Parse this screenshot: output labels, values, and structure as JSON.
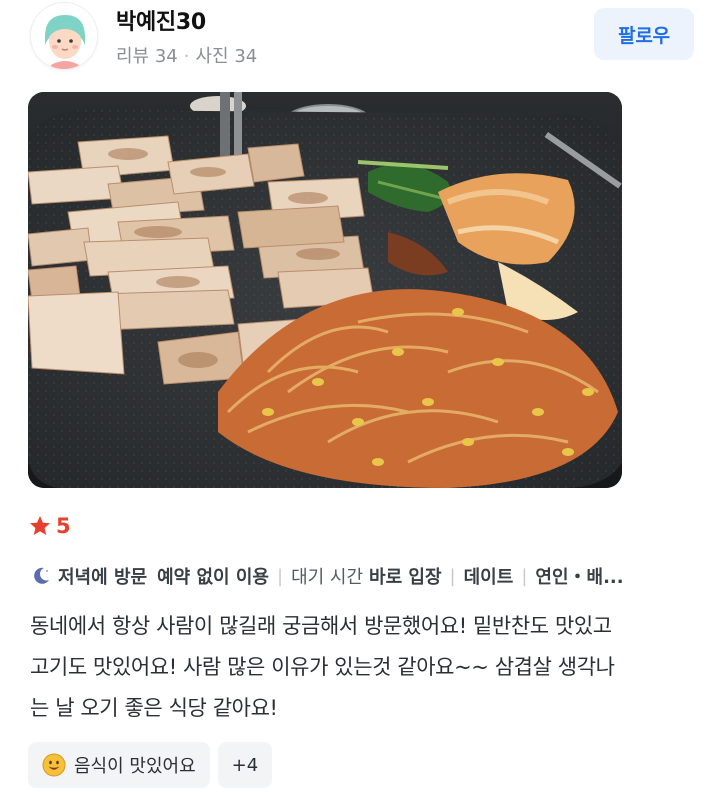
{
  "user": {
    "name": "박예진30",
    "reviews_label": "리뷰 34",
    "photos_label": "사진 34",
    "separator": "·",
    "follow_label": "팔로우"
  },
  "photo": {
    "description_icon": "food-photo"
  },
  "rating": {
    "value": "5",
    "star_color": "#e8402f"
  },
  "visit": {
    "time_label": "저녁에 방문",
    "reservation_label": "예약 없이 이용",
    "wait_prefix": "대기 시간",
    "wait_value": "바로 입장",
    "purpose_label": "데이트",
    "companion_label": "연인・배...",
    "divider": "|"
  },
  "review": {
    "lines": [
      "동네에서 항상 사람이 많길래 궁금해서 방문했어요! 밑반찬도 맛있고",
      "고기도 맛있어요! 사람 많은 이유가 있는것 같아요~~ 삼겹살 생각나",
      "는 날 오기 좋은 식당 같아요!"
    ]
  },
  "tags": {
    "first_label": "음식이 맛있어요",
    "more_label": "+4"
  },
  "colors": {
    "accent_blue": "#1f6fe5",
    "follow_bg": "#edf3fd",
    "star_red": "#e8402f"
  }
}
